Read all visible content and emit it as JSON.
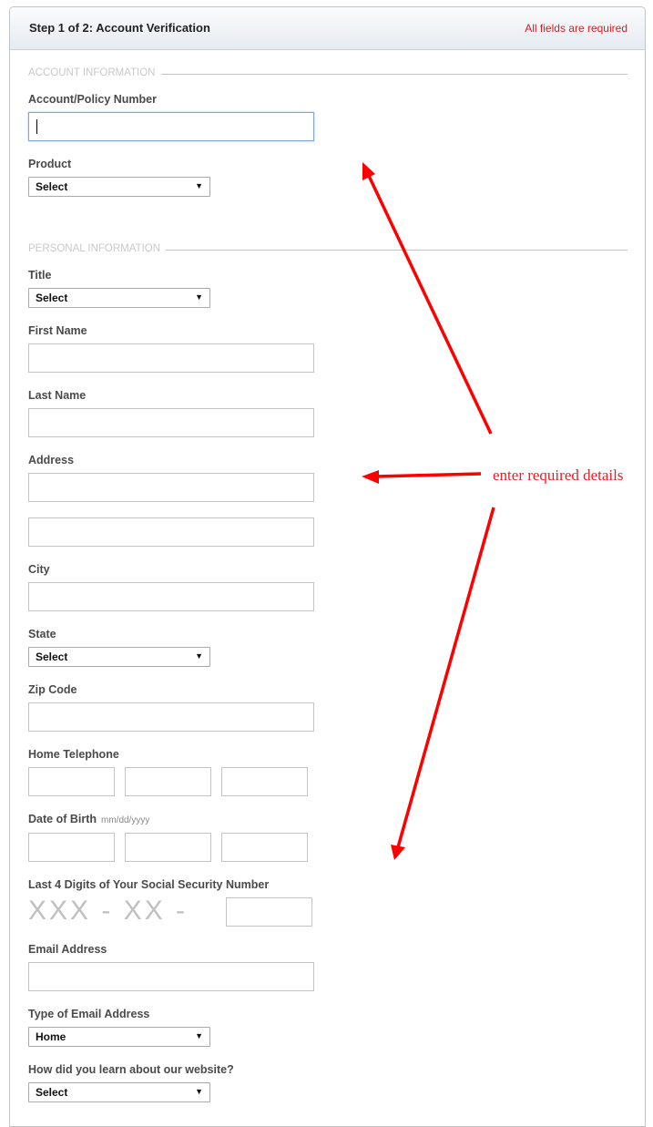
{
  "header": {
    "step_title": "Step 1 of 2: Account Verification",
    "required_note": "All fields are required"
  },
  "sections": {
    "account": "ACCOUNT INFORMATION",
    "personal": "PERSONAL INFORMATION"
  },
  "fields": {
    "account_number": {
      "label": "Account/Policy Number",
      "value": ""
    },
    "product": {
      "label": "Product",
      "selected": "Select"
    },
    "title": {
      "label": "Title",
      "selected": "Select"
    },
    "first_name": {
      "label": "First Name",
      "value": ""
    },
    "last_name": {
      "label": "Last Name",
      "value": ""
    },
    "address": {
      "label": "Address",
      "line1": "",
      "line2": ""
    },
    "city": {
      "label": "City",
      "value": ""
    },
    "state": {
      "label": "State",
      "selected": "Select"
    },
    "zip": {
      "label": "Zip Code",
      "value": ""
    },
    "home_phone": {
      "label": "Home Telephone"
    },
    "dob": {
      "label": "Date of Birth",
      "hint": "mm/dd/yyyy"
    },
    "ssn": {
      "label": "Last 4 Digits of Your Social Security Number",
      "mask": "XXX - XX -"
    },
    "email": {
      "label": "Email Address",
      "value": ""
    },
    "email_type": {
      "label": "Type of Email Address",
      "selected": "Home"
    },
    "referral": {
      "label": "How did you learn about our website?",
      "selected": "Select"
    }
  },
  "icons": {
    "dropdown_arrow": "▼"
  },
  "annotation": {
    "text": "enter required details",
    "color": "#ee1c24"
  }
}
